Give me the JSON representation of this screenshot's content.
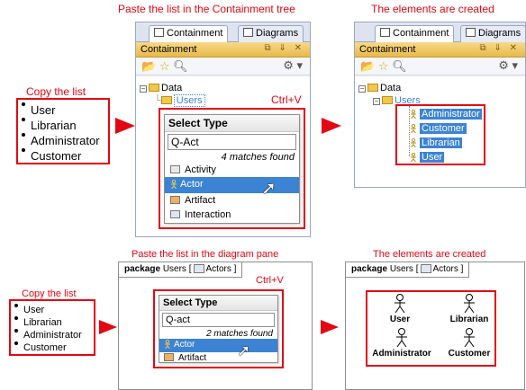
{
  "top": {
    "caption_left": "Paste the list in the Containment tree",
    "caption_right": "The elements are created",
    "copy_caption": "Copy the list",
    "list_items": [
      "User",
      "Librarian",
      "Administrator",
      "Customer"
    ],
    "ctrlv": "Ctrl+V",
    "tab_containment": "Containment",
    "tab_diagrams": "Diagrams",
    "panel_title": "Containment",
    "tree_data": "Data",
    "tree_users": "Users",
    "popup": {
      "title": "Select Type",
      "input": "Q-Act",
      "matches": "4 matches found",
      "items": [
        "Activity",
        "Actor",
        "Artifact",
        "Interaction"
      ]
    },
    "created_items": [
      "Administrator",
      "Customer",
      "Librarian",
      "User"
    ]
  },
  "bottom": {
    "caption_left": "Paste the list in the diagram pane",
    "caption_right": "The elements are created",
    "copy_caption": "Copy the list",
    "list_items": [
      "User",
      "Librarian",
      "Administrator",
      "Customer"
    ],
    "ctrlv": "Ctrl+V",
    "tab_keyword": "package",
    "tab_name": "Users",
    "tab_diagram": "Actors",
    "popup": {
      "title": "Select Type",
      "input": "Q-act",
      "matches": "2 matches found",
      "items": [
        "Actor",
        "Artifact"
      ]
    },
    "actors": [
      "User",
      "Librarian",
      "Administrator",
      "Customer"
    ]
  },
  "colors": {
    "accent_red": "#e30613",
    "selection_blue": "#3c83d4",
    "title_gold": "#e9b94a"
  }
}
